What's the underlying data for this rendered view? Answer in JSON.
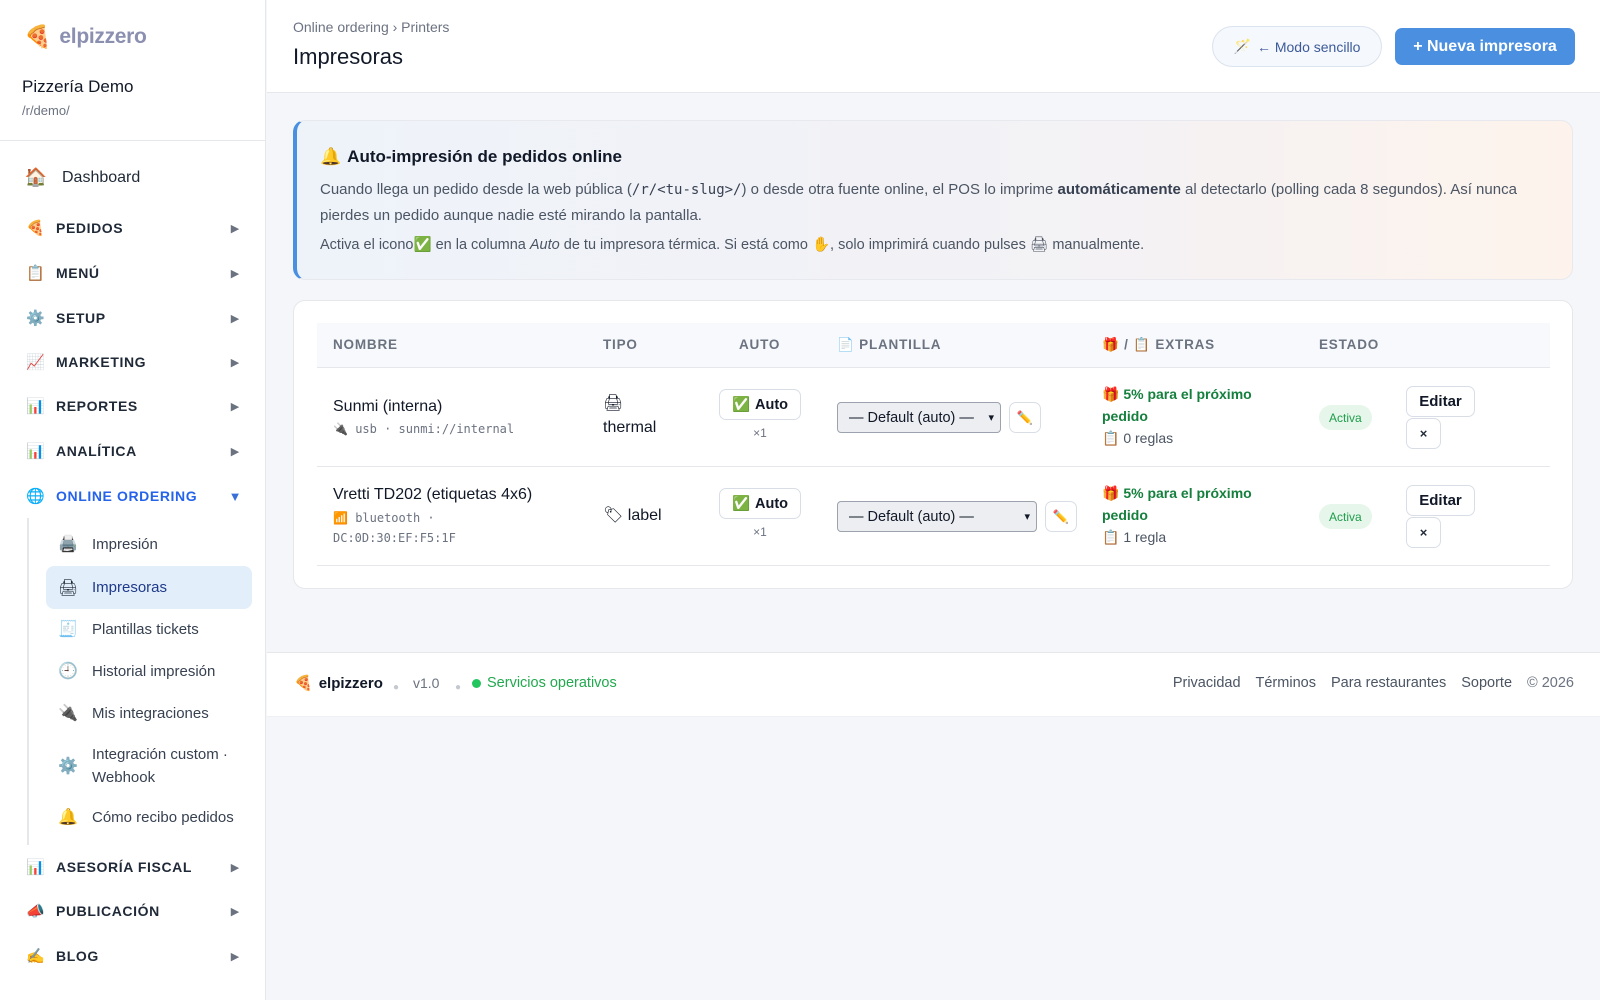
{
  "brand": {
    "name": "elpizzero",
    "logo_icon": "🍕"
  },
  "restaurant": {
    "name": "Pizzería Demo",
    "slug": "/r/demo/"
  },
  "sidebar": {
    "dashboard": {
      "icon": "🏠",
      "label": "Dashboard"
    },
    "sections": [
      {
        "icon": "🍕",
        "label": "PEDIDOS",
        "arrow": "▶"
      },
      {
        "icon": "📋",
        "label": "MENÚ",
        "arrow": "▶"
      },
      {
        "icon": "⚙️",
        "label": "SETUP",
        "arrow": "▶"
      },
      {
        "icon": "📈",
        "label": "MARKETING",
        "arrow": "▶"
      },
      {
        "icon": "📊",
        "label": "REPORTES",
        "arrow": "▶"
      },
      {
        "icon": "📊",
        "label": "ANALÍTICA",
        "arrow": "▶"
      },
      {
        "icon": "🌐",
        "label": "ONLINE ORDERING",
        "arrow": "▼"
      },
      {
        "icon": "📊",
        "label": "ASESORÍA FISCAL",
        "arrow": "▶"
      },
      {
        "icon": "📣",
        "label": "PUBLICACIÓN",
        "arrow": "▶"
      },
      {
        "icon": "✍️",
        "label": "BLOG",
        "arrow": "▶"
      }
    ],
    "online_ordering_items": [
      {
        "icon": "🖨️",
        "label": "Impresión"
      },
      {
        "icon": "🖨",
        "label": "Impresoras"
      },
      {
        "icon": "🧾",
        "label": "Plantillas tickets"
      },
      {
        "icon": "🕘",
        "label": "Historial impresión"
      },
      {
        "icon": "🔌",
        "label": "Mis integraciones"
      },
      {
        "icon": "⚙️",
        "label": "Integración custom · Webhook"
      },
      {
        "icon": "🔔",
        "label": "Cómo recibo pedidos"
      }
    ]
  },
  "header": {
    "breadcrumb": "Online ordering › Printers",
    "title": "Impresoras",
    "simple_mode": {
      "icon": "🪄",
      "label": "← Modo sencillo"
    },
    "new_printer_label": "+ Nueva impresora"
  },
  "info": {
    "icon": "🔔",
    "title": "Auto-impresión de pedidos online",
    "p1_a": "Cuando llega un pedido desde la web pública (",
    "p1_code": "/r/<tu-slug>/",
    "p1_b": ") o desde otra fuente online, el POS lo imprime ",
    "p1_bold": "automáticamente",
    "p1_c": " al detectarlo (polling cada 8 segundos). Así nunca pierdes un pedido aunque nadie esté mirando la pantalla.",
    "p2_a": "Activa el icono✅ en la columna ",
    "p2_em": "Auto",
    "p2_b": " de tu impresora térmica. Si está como ✋, solo imprimirá cuando pulses 🖨 manualmente."
  },
  "table": {
    "headers": {
      "name": "NOMBRE",
      "type": "TIPO",
      "auto": "AUTO",
      "template": "📄 PLANTILLA",
      "extras": "🎁 / 📋 EXTRAS",
      "status": "ESTADO"
    },
    "rows": [
      {
        "name": "Sunmi (interna)",
        "conn_icon": "🔌",
        "conn_line1": "usb · sunmi://internal",
        "conn_line2": "",
        "type_icon": "🖨",
        "type_label": "thermal",
        "auto_icon": "✅",
        "auto_label": "Auto",
        "copies": "×1",
        "template": "— Default (auto) —",
        "edit_template_icon": "✏️",
        "extra_promo": "🎁 5% para el próximo pedido",
        "extra_rules": "📋 0 reglas",
        "status": "Activa",
        "edit_label": "Editar",
        "delete_label": "×"
      },
      {
        "name": "Vretti TD202 (etiquetas 4x6)",
        "conn_icon": "📶",
        "conn_line1": "bluetooth ·",
        "conn_line2": "DC:0D:30:EF:F5:1F",
        "type_icon": "🏷",
        "type_label": "label",
        "auto_icon": "✅",
        "auto_label": "Auto",
        "copies": "×1",
        "template": "— Default (auto) —",
        "edit_template_icon": "✏️",
        "extra_promo": "🎁 5% para el próximo pedido",
        "extra_rules": "📋 1 regla",
        "status": "Activa",
        "edit_label": "Editar",
        "delete_label": "×"
      }
    ]
  },
  "footer": {
    "brand": "elpizzero",
    "version": "v1.0",
    "status": "Servicios operativos",
    "links": [
      "Privacidad",
      "Términos",
      "Para restaurantes",
      "Soporte"
    ],
    "copyright": "© 2026"
  }
}
